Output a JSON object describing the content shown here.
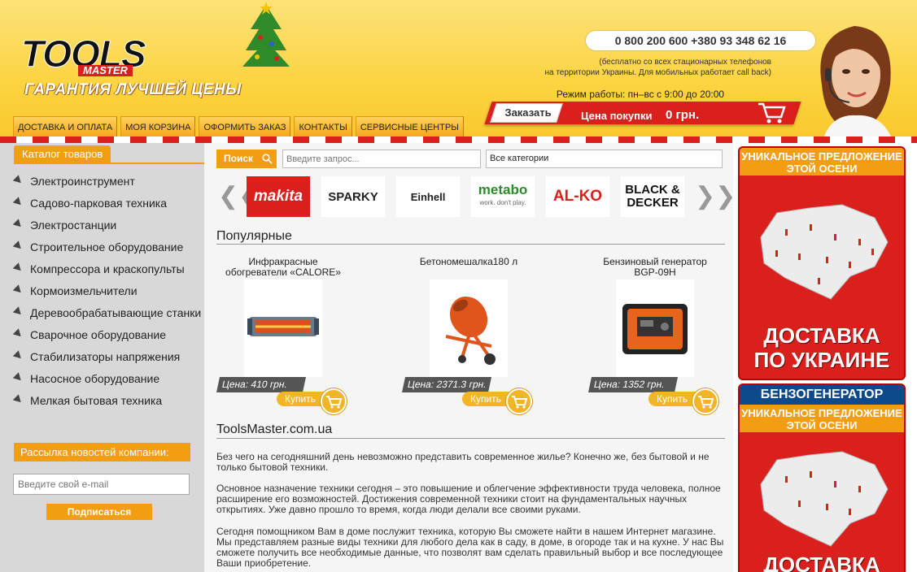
{
  "header": {
    "logo_text": "TOOLS",
    "logo_sub": "MASTER",
    "tagline": "ГАРАНТИЯ ЛУЧШЕЙ ЦЕНЫ",
    "phone": "0 800 200 600 +380 93 348 62 16",
    "phone_note_line1": "(бесплатно со всех стационарных телефонов",
    "phone_note_line2": "на территории Украины. Для мобильных работает call back)",
    "hours": "Режим работы: пн–вс с 9:00 до 20:00",
    "order_button": "Заказать",
    "price_label": "Цена покупки",
    "price_value": "0 грн."
  },
  "nav": {
    "items": [
      "Доставка и оплата",
      "Моя корзина",
      "Оформить заказ",
      "Контакты",
      "Сервисные центры"
    ]
  },
  "sidebar": {
    "catalog_title": "Каталог товаров",
    "categories": [
      "Электроинструмент",
      "Садово-парковая техника",
      "Электростанции",
      "Строительное оборудование",
      "Компрессора и краскопульты",
      "Кормоизмельчители",
      "Деревообрабатывающие станки",
      "Сварочное оборудование",
      "Стабилизаторы напряжения",
      "Насосное оборудование",
      "Мелкая бытовая техника"
    ],
    "newsletter_title": "Рассылка новостей компании:",
    "email_placeholder": "Введите свой e-mail",
    "subscribe_button": "Подписаться"
  },
  "search": {
    "button": "Поиск",
    "placeholder": "Введите запрос...",
    "category": "Все категории"
  },
  "brands": [
    "makita",
    "SPARKY",
    "Einhell",
    "metabo",
    "AL-KO",
    "BLACK & DECKER"
  ],
  "brand_metabo_sub": "work. don't play.",
  "popular": {
    "title": "Популярные",
    "buy_label": "Купить",
    "products": [
      {
        "name_line1": "Инфракрасные",
        "name_line2": "обогреватели «CALORE»",
        "price": "Цена: 410 грн."
      },
      {
        "name_line1": "Бетономешалка180 л",
        "name_line2": "",
        "price": "Цена: 2371.3 грн."
      },
      {
        "name_line1": "Бензиновый генератор",
        "name_line2": "BGP-09H",
        "price": "Цена: 1352 грн."
      }
    ]
  },
  "about": {
    "title": "ToolsMaster.com.ua",
    "paragraphs": [
      "Без чего на сегодняшний день невозможно представить современное жилье? Конечно же, без бытовой и не только бытовой техники.",
      "Основное назначение техники сегодня – это повышение и облегчение эффективности труда человека, полное расширение его возможностей. Достижения современной техники стоит на фундаментальных научных открытиях. Уже давно прошло то время, когда люди делали все своими руками.",
      "Сегодня помощником Вам в доме послужит техника, которую Вы сможете найти в нашем Интернет магазине. Мы представляем разные виды техники для любого дела как в саду, в доме, в огороде так и на кухне. У нас Вы сможете получить все необходимые данные, что позволят вам сделать правильный выбор и все последующее Ваши приобретение."
    ]
  },
  "banners": {
    "b1_top": "УНИКАЛЬНОЕ ПРЕДЛОЖЕНИЕ ЭТОЙ ОСЕНИ",
    "b1_big1": "ДОСТАВКА",
    "b1_big2": "ПО УКРАИНЕ",
    "b2_head": "БЕНЗОГЕНЕРАТОР",
    "b2_top": "УНИКАЛЬНОЕ ПРЕДЛОЖЕНИЕ ЭТОЙ ОСЕНИ",
    "b2_big": "ДОСТАВКА"
  },
  "colors": {
    "accent": "#f39d13",
    "brand_red": "#d9201c",
    "header_yellow": "#fcd33f"
  }
}
